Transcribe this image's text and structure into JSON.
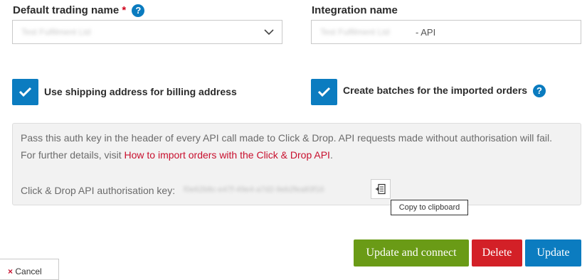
{
  "trading": {
    "label": "Default trading name",
    "required_mark": "*",
    "help": "?",
    "value": "Test Fulfilment Ltd"
  },
  "integration": {
    "label": "Integration name",
    "value_prefix": "Test Fulfilment Ltd",
    "value_suffix": "- API"
  },
  "options": {
    "shipping_billing": {
      "label": "Use shipping address for billing address",
      "checked": true
    },
    "create_batches": {
      "label": "Create batches for the imported orders",
      "checked": true,
      "help": "?"
    }
  },
  "auth_panel": {
    "line1": "Pass this auth key in the header of every API call made to Click & Drop. API requests made without authorisation will fail.",
    "line2_prefix": "For further details, visit ",
    "link_text": "How to import orders with the Click & Drop API",
    "line2_suffix": ".",
    "key_label": "Click & Drop API authorisation key:",
    "key_value": "f0e62b8c-e47f-49e4-a7d2-9eb2fea83f16",
    "copy_tooltip": "Copy to clipboard"
  },
  "buttons": {
    "update_connect": "Update and connect",
    "delete": "Delete",
    "update": "Update",
    "cancel": "Cancel"
  },
  "colors": {
    "primary": "#0b7cc0",
    "success": "#6a9b16",
    "danger": "#d32027",
    "link": "#c8102e"
  },
  "icons": [
    "help-icon",
    "chevron-down-icon",
    "checkmark-icon",
    "copy-clipboard-icon",
    "close-icon"
  ]
}
